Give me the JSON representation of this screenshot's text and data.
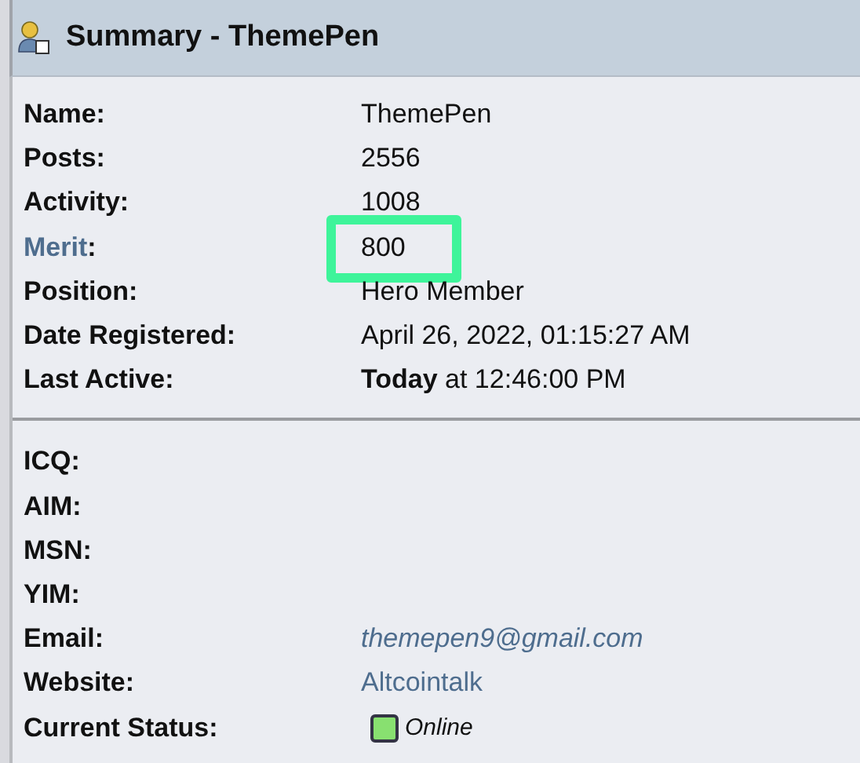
{
  "header": {
    "title": "Summary - ThemePen"
  },
  "sections": [
    {
      "rows": [
        {
          "label": "Name:",
          "label_is_link": false,
          "value": "ThemePen",
          "kind": "text",
          "highlighted": false
        },
        {
          "label": "Posts:",
          "label_is_link": false,
          "value": "2556",
          "kind": "text",
          "highlighted": false
        },
        {
          "label": "Activity:",
          "label_is_link": false,
          "value": "1008",
          "kind": "text",
          "highlighted": false
        },
        {
          "label": "Merit",
          "label_suffix": ":",
          "label_is_link": true,
          "value": "800",
          "kind": "text",
          "highlighted": true
        },
        {
          "label": "Position:",
          "label_is_link": false,
          "value": "Hero Member",
          "kind": "text",
          "highlighted": false
        },
        {
          "label": "Date Registered:",
          "label_is_link": false,
          "value": "April 26, 2022, 01:15:27 AM",
          "kind": "text",
          "highlighted": false
        },
        {
          "label": "Last Active:",
          "label_is_link": false,
          "value": "**Today** at 12:46:00 PM",
          "kind": "text",
          "highlighted": false
        }
      ]
    },
    {
      "rows": [
        {
          "label": "ICQ:",
          "label_is_link": false,
          "kind": "empty",
          "highlighted": false
        },
        {
          "label": "AIM:",
          "label_is_link": false,
          "kind": "empty",
          "highlighted": false
        },
        {
          "label": "MSN:",
          "label_is_link": false,
          "kind": "empty",
          "highlighted": false
        },
        {
          "label": "YIM:",
          "label_is_link": false,
          "kind": "empty",
          "highlighted": false
        },
        {
          "label": "Email:",
          "label_is_link": false,
          "value": "themepen9@gmail.com",
          "kind": "email",
          "highlighted": false
        },
        {
          "label": "Website:",
          "label_is_link": false,
          "value": "Altcointalk",
          "kind": "link",
          "highlighted": false
        },
        {
          "label": "Current Status:",
          "label_is_link": false,
          "value": "Online",
          "kind": "status",
          "online": true,
          "highlighted": false
        }
      ]
    }
  ]
}
